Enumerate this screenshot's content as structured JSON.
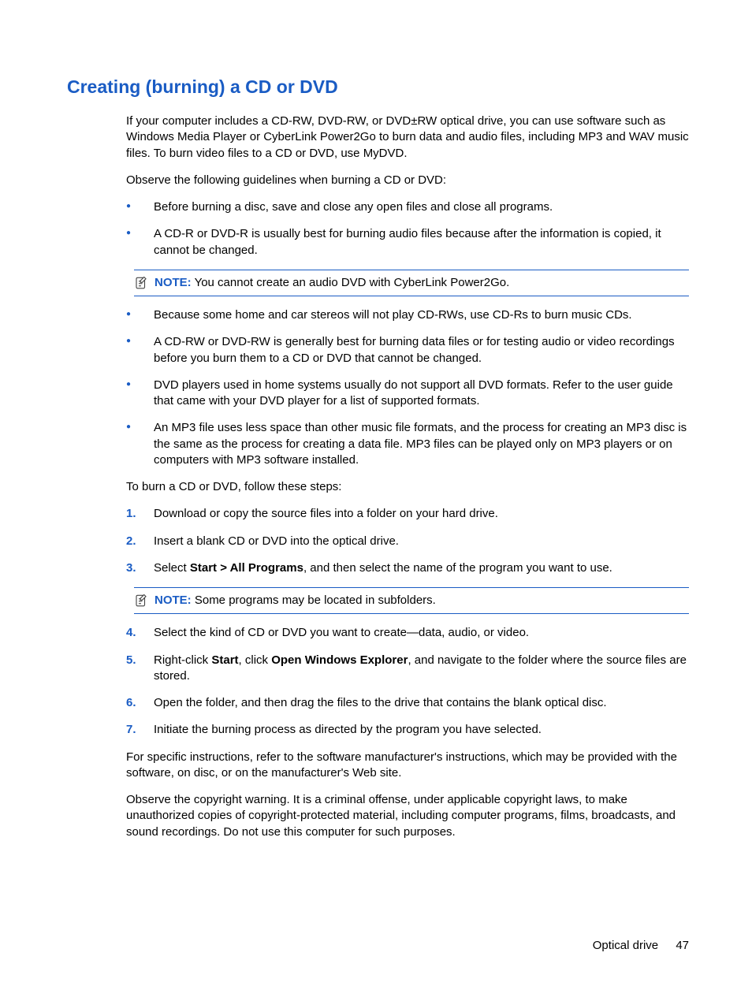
{
  "heading": "Creating (burning) a CD or DVD",
  "intro": "If your computer includes a CD-RW, DVD-RW, or DVD±RW optical drive, you can use software such as Windows Media Player or CyberLink Power2Go to burn data and audio files, including MP3 and WAV music files. To burn video files to a CD or DVD, use MyDVD.",
  "guidelines_intro": "Observe the following guidelines when burning a CD or DVD:",
  "bullets1": [
    "Before burning a disc, save and close any open files and close all programs.",
    "A CD-R or DVD-R is usually best for burning audio files because after the information is copied, it cannot be changed."
  ],
  "note1": {
    "label": "NOTE:",
    "text": "You cannot create an audio DVD with CyberLink Power2Go."
  },
  "bullets2": [
    "Because some home and car stereos will not play CD-RWs, use CD-Rs to burn music CDs.",
    "A CD-RW or DVD-RW is generally best for burning data files or for testing audio or video recordings before you burn them to a CD or DVD that cannot be changed.",
    "DVD players used in home systems usually do not support all DVD formats. Refer to the user guide that came with your DVD player for a list of supported formats.",
    "An MP3 file uses less space than other music file formats, and the process for creating an MP3 disc is the same as the process for creating a data file. MP3 files can be played only on MP3 players or on computers with MP3 software installed."
  ],
  "steps_intro": "To burn a CD or DVD, follow these steps:",
  "steps1": {
    "1": "Download or copy the source files into a folder on your hard drive.",
    "2": "Insert a blank CD or DVD into the optical drive.",
    "3_pre": "Select ",
    "3_bold": "Start > All Programs",
    "3_post": ", and then select the name of the program you want to use."
  },
  "note2": {
    "label": "NOTE:",
    "text": "Some programs may be located in subfolders."
  },
  "steps2": {
    "4": "Select the kind of CD or DVD you want to create—data, audio, or video.",
    "5_pre": "Right-click ",
    "5_b1": "Start",
    "5_mid": ", click ",
    "5_b2": "Open Windows Explorer",
    "5_post": ", and navigate to the folder where the source files are stored.",
    "6": "Open the folder, and then drag the files to the drive that contains the blank optical disc.",
    "7": "Initiate the burning process as directed by the program you have selected."
  },
  "closing1": "For specific instructions, refer to the software manufacturer's instructions, which may be provided with the software, on disc, or on the manufacturer's Web site.",
  "closing2": "Observe the copyright warning. It is a criminal offense, under applicable copyright laws, to make unauthorized copies of copyright-protected material, including computer programs, films, broadcasts, and sound recordings. Do not use this computer for such purposes.",
  "footer": {
    "section": "Optical drive",
    "page": "47"
  }
}
